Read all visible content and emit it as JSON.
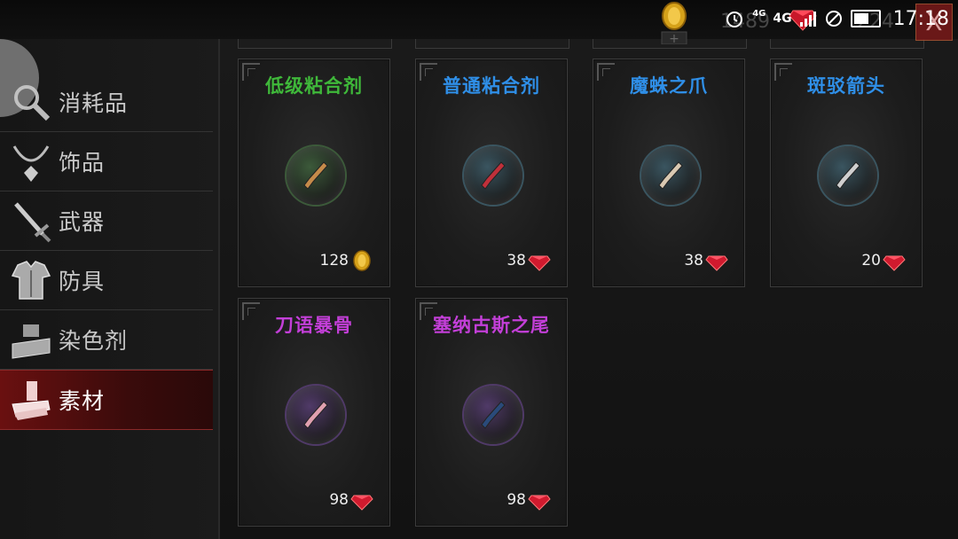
{
  "status_bar": {
    "network_small": "4G",
    "network": "4G",
    "time": "17:18"
  },
  "currency": {
    "gold": "1489",
    "gems": "224",
    "close_label": "X"
  },
  "sidebar": {
    "items": [
      {
        "label": "消耗品",
        "icon": "magnifier-icon",
        "active": false
      },
      {
        "label": "饰品",
        "icon": "necklace-icon",
        "active": false
      },
      {
        "label": "武器",
        "icon": "sword-icon",
        "active": false
      },
      {
        "label": "防具",
        "icon": "armor-icon",
        "active": false
      },
      {
        "label": "染色剂",
        "icon": "dye-pot-icon",
        "active": false
      },
      {
        "label": "素材",
        "icon": "scroll-material-icon",
        "active": true
      }
    ]
  },
  "shop_items": [
    {
      "name": "低级粘合剂",
      "price": "128",
      "currency": "gold",
      "name_color": "#3fb83a",
      "orb_color": "#3c5a3a",
      "item_color": "#c58b4a"
    },
    {
      "name": "普通粘合剂",
      "price": "38",
      "currency": "gem",
      "name_color": "#2f8fe8",
      "orb_color": "#3a5560",
      "item_color": "#c0303a"
    },
    {
      "name": "魔蛛之爪",
      "price": "38",
      "currency": "gem",
      "name_color": "#2f8fe8",
      "orb_color": "#3a5560",
      "item_color": "#d9c9b2"
    },
    {
      "name": "斑驳箭头",
      "price": "20",
      "currency": "gem",
      "name_color": "#2f8fe8",
      "orb_color": "#3a5560",
      "item_color": "#cfcfcf"
    },
    {
      "name": "刀语暴骨",
      "price": "98",
      "currency": "gem",
      "name_color": "#c33fd8",
      "orb_color": "#503a68",
      "item_color": "#e0a0b0"
    },
    {
      "name": "塞纳古斯之尾",
      "price": "98",
      "currency": "gem",
      "name_color": "#c33fd8",
      "orb_color": "#503a68",
      "item_color": "#2a4a7a"
    }
  ]
}
